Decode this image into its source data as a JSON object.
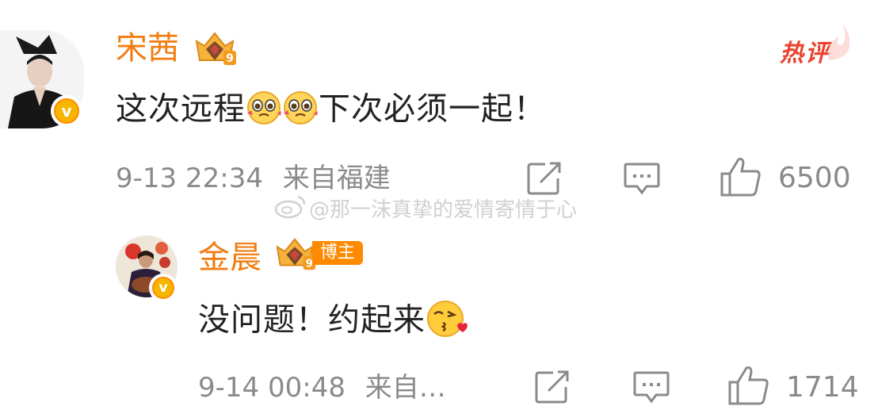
{
  "comments": [
    {
      "username": "宋茜",
      "text_before": "这次远程",
      "text_after": "下次必须一起！",
      "emojis": [
        "pleading-face",
        "pleading-face"
      ],
      "time": "9-13 22:34",
      "location": "来自福建",
      "likes": "6500",
      "tag": "热评",
      "verified": true
    }
  ],
  "replies": [
    {
      "username": "金晨",
      "role_badge": "博主",
      "text": "没问题！约起来",
      "emoji": "kissing-face-with-heart",
      "time": "9-14 00:48",
      "location": "来自…",
      "likes": "1714",
      "verified": true
    }
  ],
  "watermark": "@那一沫真挚的爱情寄情于心",
  "colors": {
    "username": "#f07e12",
    "hot_tag": "#e8432e",
    "meta": "#8a8a8a",
    "badge": "#ff8a00"
  }
}
